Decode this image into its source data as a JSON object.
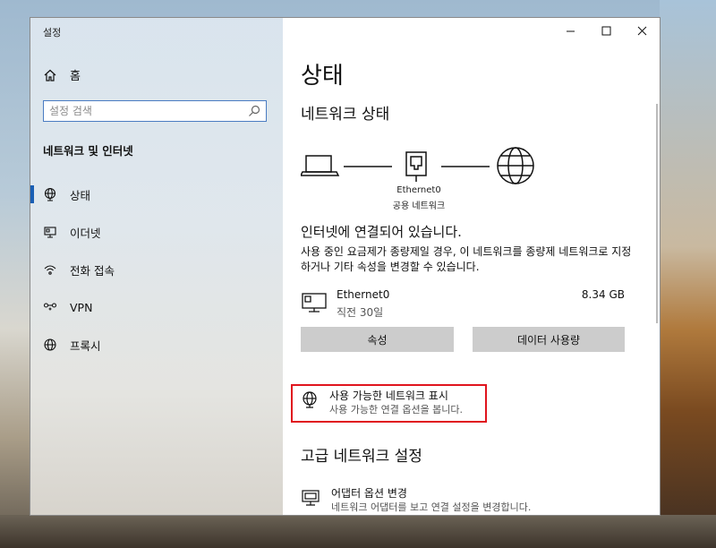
{
  "window": {
    "title": "설정"
  },
  "sidebar": {
    "home_label": "홈",
    "search_placeholder": "설정 검색",
    "section_heading": "네트워크 및 인터넷",
    "items": [
      {
        "label": "상태",
        "icon": "globe-status-icon",
        "active": true
      },
      {
        "label": "이더넷",
        "icon": "ethernet-icon",
        "active": false
      },
      {
        "label": "전화 접속",
        "icon": "dialup-icon",
        "active": false
      },
      {
        "label": "VPN",
        "icon": "vpn-icon",
        "active": false
      },
      {
        "label": "프록시",
        "icon": "globe-icon",
        "active": false
      }
    ]
  },
  "main": {
    "page_title": "상태",
    "network_status_heading": "네트워크 상태",
    "diagram": {
      "adapter_name": "Ethernet0",
      "network_type": "공용 네트워크"
    },
    "connection_status": "인터넷에 연결되어 있습니다.",
    "connection_description": "사용 중인 요금제가 종량제일 경우, 이 네트워크를 종량제 네트워크로 지정하거나 기타 속성을 변경할 수 있습니다.",
    "adapter": {
      "name": "Ethernet0",
      "time": "직전 30일",
      "data_used": "8.34 GB"
    },
    "buttons": {
      "properties": "속성",
      "data_usage": "데이터 사용량"
    },
    "show_networks": {
      "title": "사용 가능한 네트워크 표시",
      "description": "사용 가능한 연결 옵션을 봅니다."
    },
    "advanced_heading": "고급 네트워크 설정",
    "adapter_options": {
      "title": "어댑터 옵션 변경",
      "description": "네트워크 어댑터를 보고 연결 설정을 변경합니다."
    }
  },
  "colors": {
    "accent": "#1a5fb4",
    "highlight": "#e0141e",
    "button_bg": "#cccccc"
  }
}
